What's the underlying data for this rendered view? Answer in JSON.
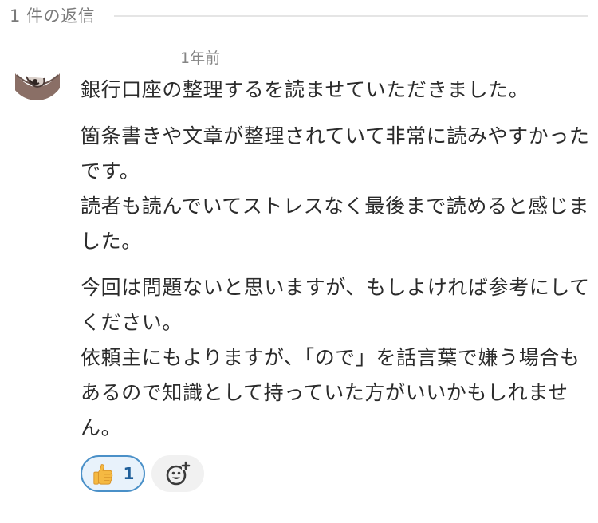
{
  "thread": {
    "reply_count_label": "1 件の返信"
  },
  "comment": {
    "timestamp": "1年前",
    "paragraphs": [
      "銀行口座の整理するを読ませていただきました。",
      "箇条書きや文章が整理されていて非常に読みやすかったです。\n読者も読んでいてストレスなく最後まで読めると感じました。",
      "今回は問題ないと思いますが、もしよければ参考にしてください。\n依頼主にもよりますが、「ので」を話言葉で嫌う場合もあるので知識として持っていた方がいいかもしれません。"
    ]
  },
  "reactions": {
    "items": [
      {
        "icon": "thumbs-up-icon",
        "count": "1"
      }
    ],
    "add_icon": "add-emoji-icon",
    "accent_color": "#4a90c8"
  }
}
